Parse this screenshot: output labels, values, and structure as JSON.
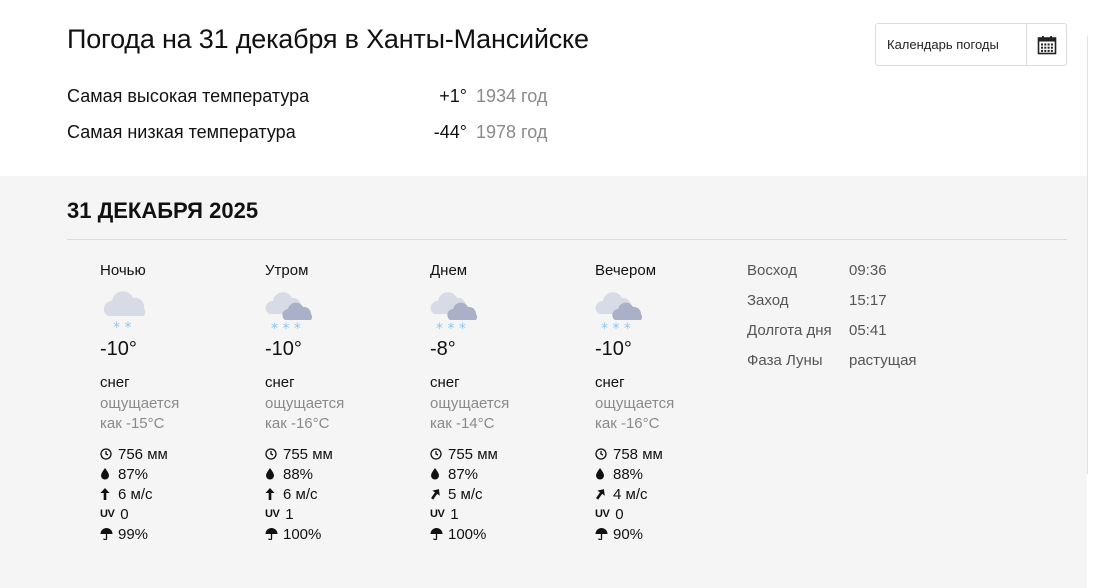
{
  "header": {
    "title": "Погода на 31 декабря в Ханты-Мансийске",
    "calendar_button": "Календарь погоды",
    "records": [
      {
        "label": "Самая высокая температура",
        "value": "+1°",
        "year": "1934 год"
      },
      {
        "label": "Самая низкая температура",
        "value": "-44°",
        "year": "1978 год"
      }
    ]
  },
  "day": {
    "date": "31 ДЕКАБРЯ 2025",
    "periods": [
      {
        "name": "Ночью",
        "icon": "cloud-light-snow-icon",
        "temp": "-10°",
        "condition": "снег",
        "feels_1": "ощущается",
        "feels_2": "как -15°C",
        "pressure": "756 мм",
        "humidity": "87%",
        "wind": "6 м/с",
        "uv_label": "UV",
        "uv": "0",
        "precip": "99%"
      },
      {
        "name": "Утром",
        "icon": "cloud-snow-icon",
        "temp": "-10°",
        "condition": "снег",
        "feels_1": "ощущается",
        "feels_2": "как -16°C",
        "pressure": "755 мм",
        "humidity": "88%",
        "wind": "6 м/с",
        "uv_label": "UV",
        "uv": "1",
        "precip": "100%"
      },
      {
        "name": "Днем",
        "icon": "cloud-snow-icon",
        "temp": "-8°",
        "condition": "снег",
        "feels_1": "ощущается",
        "feels_2": "как -14°C",
        "pressure": "755 мм",
        "humidity": "87%",
        "wind": "5 м/с",
        "uv_label": "UV",
        "uv": "1",
        "precip": "100%"
      },
      {
        "name": "Вечером",
        "icon": "cloud-snow-icon",
        "temp": "-10°",
        "condition": "снег",
        "feels_1": "ощущается",
        "feels_2": "как -16°C",
        "pressure": "758 мм",
        "humidity": "88%",
        "wind": "4 м/с",
        "uv_label": "UV",
        "uv": "0",
        "precip": "90%"
      }
    ],
    "sun": [
      {
        "label": "Восход",
        "value": "09:36"
      },
      {
        "label": "Заход",
        "value": "15:17"
      },
      {
        "label": "Долгота дня",
        "value": "05:41"
      },
      {
        "label": "Фаза Луны",
        "value": "растущая"
      }
    ]
  },
  "colors": {
    "muted_text": "#8a8a8a",
    "section_bg": "#f5f5f5",
    "cloud_light": "#d6dbe6",
    "cloud_dark": "#a9b0c7",
    "snow": "#8fc6f0"
  }
}
